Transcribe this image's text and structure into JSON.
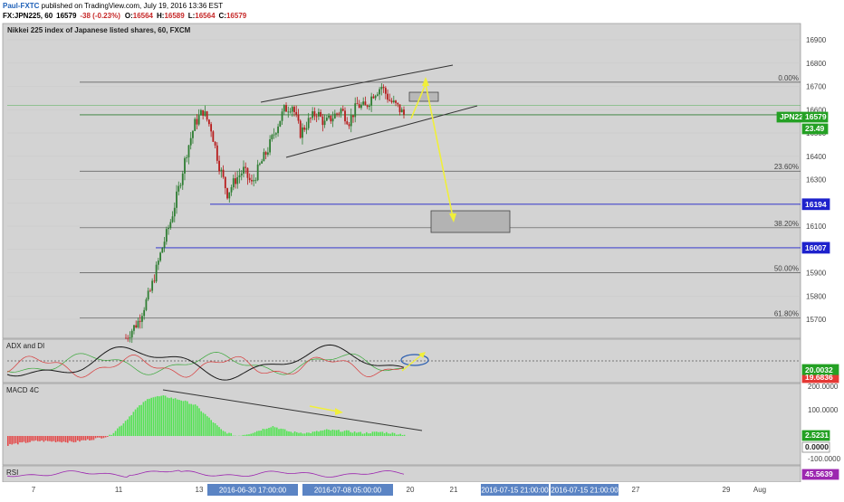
{
  "header": {
    "publisher_name": "Paul-FXTC",
    "published_text": " published on TradingView.com, July 19, 2016 13:36 EST",
    "symbol_text": "FX:JPN225, 60",
    "last_price": "16579",
    "change_text": "-38 (-0.23%)",
    "o_label": "O:",
    "o_value": "16564",
    "h_label": "H:",
    "h_value": "16589",
    "l_label": "L:",
    "l_value": "16564",
    "c_label": "C:",
    "c_value": "16579"
  },
  "colors": {
    "background": "#ffffff",
    "panel_bg": "#d3d3d3",
    "up_candle": "#2e7d32",
    "down_candle": "#b71c1c",
    "fib_line": "#555555",
    "blue_level": "#1e22cc",
    "arrow": "#f0ef3a",
    "macd_up": "#54e354",
    "macd_down": "#e44848",
    "rsi": "#9c27b0",
    "adx_line": "#1a1a1a",
    "di_plus": "#3aa83a",
    "di_minus": "#d83a3a",
    "price_tag_green": "#24a124",
    "level_tag_blue": "#1e22cc",
    "date_tag_bg": "#5b84c4"
  },
  "chart_data": {
    "type": "candlestick",
    "title": "Nikkei 225 index of Japanese listed shares, 60, FXCM",
    "price_axis": {
      "ticks": [
        "16900",
        "16800",
        "16700",
        "16600",
        "16500",
        "16400",
        "16300",
        "16200",
        "16100",
        "16000",
        "15900",
        "15800",
        "15700"
      ],
      "ylim": [
        15650,
        16970
      ]
    },
    "price_labels": {
      "symbol_tag": "JPN225",
      "last": "16579",
      "change_box": "23.49",
      "level_1": "16194",
      "level_2": "16007"
    },
    "levels": [
      {
        "name": "support-1",
        "value": 16194
      },
      {
        "name": "support-2",
        "value": 16007
      }
    ],
    "fibonacci": [
      {
        "label": "0.00%",
        "value": 16718
      },
      {
        "label": "23.60%",
        "value": 16336
      },
      {
        "label": "38.20%",
        "value": 16093
      },
      {
        "label": "50.00%",
        "value": 15900
      },
      {
        "label": "61.80%",
        "value": 15706
      }
    ],
    "date_axis": {
      "ticks": [
        "7",
        "11",
        "13",
        "20",
        "21",
        "27",
        "29",
        "Aug"
      ],
      "highlighted_labels": [
        "2016-06-30 17:00:00",
        "2016-07-08 05:00:00",
        "2016-07-15 21:00:00",
        "2016-07-15 21:00:00"
      ]
    },
    "indicators": {
      "adx": {
        "label": "ADX and DI",
        "values": [
          "20.0032",
          "19.6836"
        ]
      },
      "macd": {
        "label": "MACD 4C",
        "ticks": [
          "200.0000",
          "100.0000",
          "-100.0000"
        ],
        "values": [
          "2.5231",
          "0.0000"
        ]
      },
      "rsi": {
        "label": "RSI",
        "values": [
          "45.5639"
        ]
      }
    }
  }
}
